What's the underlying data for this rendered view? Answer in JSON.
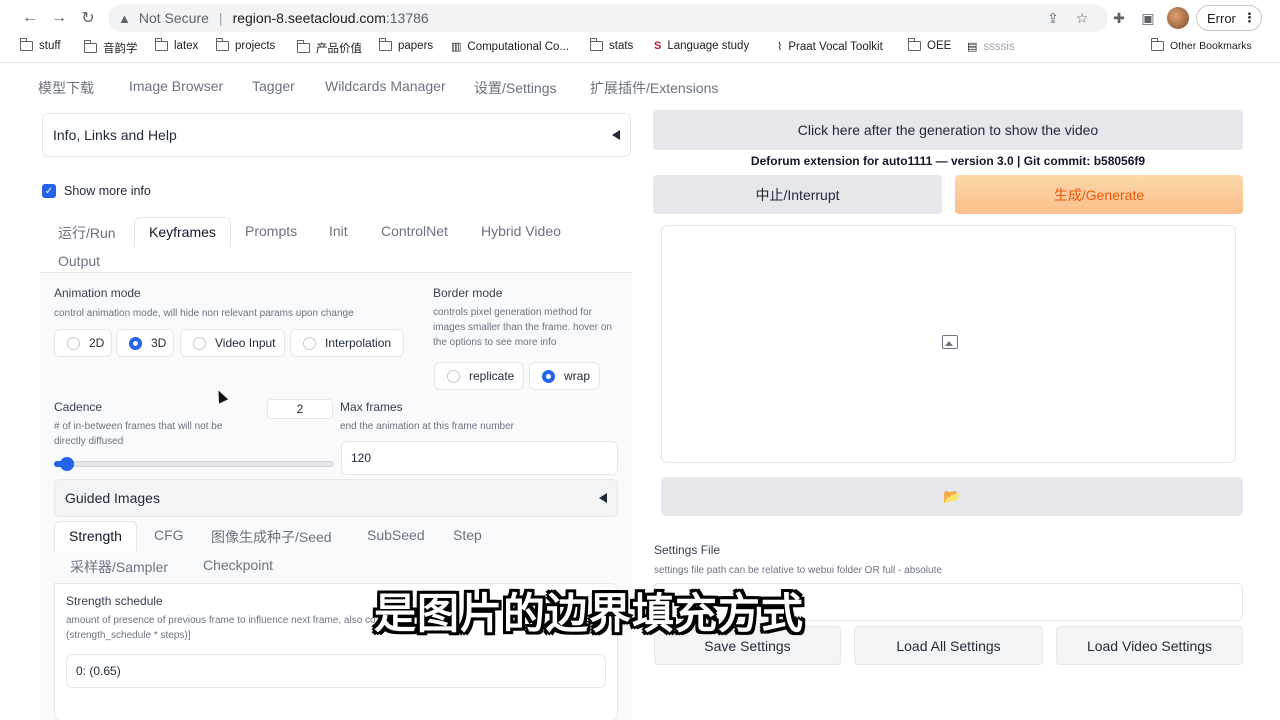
{
  "browser": {
    "security_label": "Not Secure",
    "url_host": "region-8.seetacloud.com",
    "url_port": ":13786",
    "error_label": "Error",
    "icons": [
      "back-icon",
      "forward-icon",
      "reload-icon",
      "warning-icon",
      "share-icon",
      "star-icon",
      "extensions-icon",
      "sidepanel-icon",
      "menu-dots-icon"
    ]
  },
  "bookmarks": [
    {
      "label": "stuff",
      "icon": "folder-icon"
    },
    {
      "label": "音韵学",
      "icon": "folder-icon"
    },
    {
      "label": "latex",
      "icon": "folder-icon"
    },
    {
      "label": "projects",
      "icon": "folder-icon"
    },
    {
      "label": "产品价值",
      "icon": "folder-icon"
    },
    {
      "label": "papers",
      "icon": "folder-icon"
    },
    {
      "label": "Computational Co...",
      "icon": "page-icon"
    },
    {
      "label": "stats",
      "icon": "folder-icon"
    },
    {
      "label": "Language study",
      "icon": "s-logo-icon"
    },
    {
      "label": "Praat Vocal Toolkit",
      "icon": "waveform-icon"
    },
    {
      "label": "OEE",
      "icon": "folder-icon"
    },
    {
      "label": "ssssis",
      "icon": "book-icon"
    },
    {
      "label": "Other Bookmarks",
      "icon": "folder-icon"
    }
  ],
  "top_tabs": [
    "模型下载",
    "Image Browser",
    "Tagger",
    "Wildcards Manager",
    "设置/Settings",
    "扩展插件/Extensions"
  ],
  "left": {
    "info_accordion": "Info, Links and Help",
    "show_more_info": "Show more info",
    "tabs": [
      "运行/Run",
      "Keyframes",
      "Prompts",
      "Init",
      "ControlNet",
      "Hybrid Video",
      "Output"
    ],
    "active_tab": "Keyframes",
    "animation_mode": {
      "label": "Animation mode",
      "hint": "control animation mode, will hide non relevant params upon change",
      "options": [
        "2D",
        "3D",
        "Video Input",
        "Interpolation"
      ],
      "selected": "3D"
    },
    "border_mode": {
      "label": "Border mode",
      "hint": "controls pixel generation method for images smaller than the frame. hover on the options to see more info",
      "options": [
        "replicate",
        "wrap"
      ],
      "selected": "wrap"
    },
    "cadence": {
      "label": "Cadence",
      "hint": "# of in-between frames that will not be directly diffused",
      "value": "2",
      "slider_fraction": 0.02
    },
    "max_frames": {
      "label": "Max frames",
      "hint": "end the animation at this frame number",
      "value": "120"
    },
    "guided_images": {
      "label": "Guided Images",
      "tabs": [
        "Strength",
        "CFG",
        "图像生成种子/Seed",
        "SubSeed",
        "Step",
        "采样器/Sampler",
        "Checkpoint"
      ],
      "active_tab": "Strength",
      "strength_schedule": {
        "label": "Strength schedule",
        "hint_line1": "amount of presence of previous frame to influence next frame, also co",
        "hint_line2": "(strength_schedule * steps)]",
        "value": "0: (0.65)"
      }
    }
  },
  "right": {
    "show_video_button": "Click here after the generation to show the video",
    "version_text": "Deforum extension for auto1111 — version 3.0 | Git commit: b58056f9",
    "interrupt_button": "中止/Interrupt",
    "generate_button": "生成/Generate",
    "gallery_folder_icon": "📂",
    "settings_file": {
      "label": "Settings File",
      "hint": "settings file path can be relative to webui folder OR full - absolute"
    },
    "save_settings": "Save Settings",
    "load_all_settings": "Load All Settings",
    "load_video_settings": "Load Video Settings"
  },
  "subtitle": "是图片的边界填充方式"
}
